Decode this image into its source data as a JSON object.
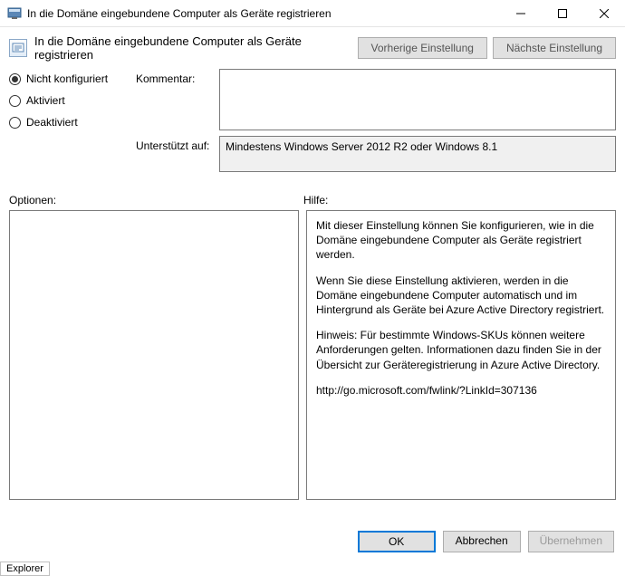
{
  "window": {
    "title": "In die Domäne eingebundene Computer als Geräte registrieren"
  },
  "header": {
    "title": "In die Domäne eingebundene Computer als Geräte registrieren",
    "prev": "Vorherige Einstellung",
    "next": "Nächste Einstellung"
  },
  "state": {
    "options": [
      {
        "label": "Nicht konfiguriert",
        "checked": true
      },
      {
        "label": "Aktiviert",
        "checked": false
      },
      {
        "label": "Deaktiviert",
        "checked": false
      }
    ]
  },
  "fields": {
    "comment_label": "Kommentar:",
    "comment_value": "",
    "supported_label": "Unterstützt auf:",
    "supported_value": "Mindestens Windows Server 2012 R2 oder Windows 8.1"
  },
  "labels": {
    "options": "Optionen:",
    "help": "Hilfe:"
  },
  "help": {
    "p1": "Mit dieser Einstellung können Sie konfigurieren, wie in die Domäne eingebundene Computer als Geräte registriert werden.",
    "p2": "Wenn Sie diese Einstellung aktivieren, werden in die Domäne eingebundene Computer automatisch und im Hintergrund als Geräte bei Azure Active Directory registriert.",
    "p3": "Hinweis: Für bestimmte Windows-SKUs können weitere Anforderungen gelten. Informationen dazu finden Sie in der Übersicht zur Geräteregistrierung in Azure Active Directory.",
    "p4": "http://go.microsoft.com/fwlink/?LinkId=307136"
  },
  "buttons": {
    "ok": "OK",
    "cancel": "Abbrechen",
    "apply": "Übernehmen"
  },
  "status": "Explorer"
}
